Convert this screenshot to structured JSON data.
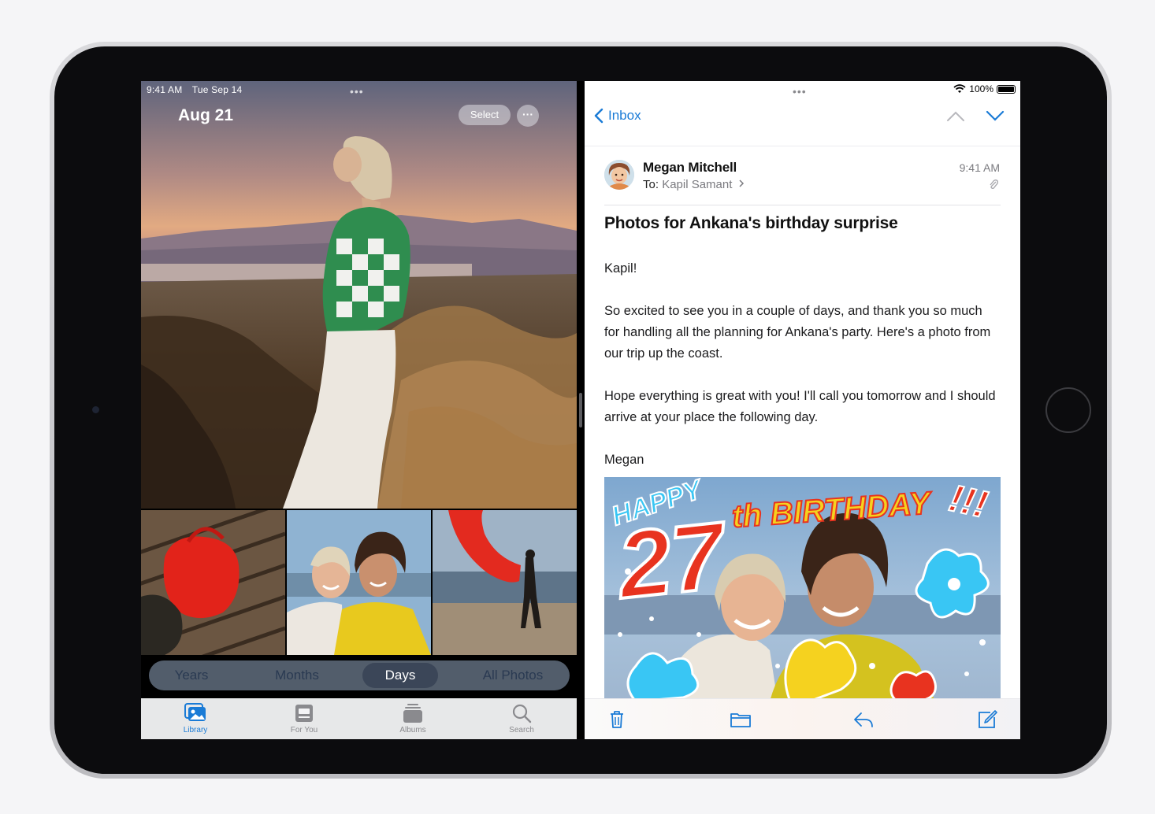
{
  "status": {
    "time": "9:41 AM",
    "date": "Tue Sep 14",
    "battery": "100%"
  },
  "photos": {
    "date_title": "Aug 21",
    "select_label": "Select",
    "more_label": "···",
    "segments": [
      "Years",
      "Months",
      "Days",
      "All Photos"
    ],
    "active_segment": "Days",
    "tabs": [
      {
        "label": "Library",
        "icon": "photo-library-icon",
        "active": true
      },
      {
        "label": "For You",
        "icon": "for-you-icon",
        "active": false
      },
      {
        "label": "Albums",
        "icon": "albums-icon",
        "active": false
      },
      {
        "label": "Search",
        "icon": "search-icon",
        "active": false
      }
    ]
  },
  "mail": {
    "back_label": "Inbox",
    "sender": "Megan Mitchell",
    "to_prefix": "To:",
    "recipient": "Kapil Samant",
    "time": "9:41 AM",
    "subject": "Photos for Ankana's birthday surprise",
    "greeting": "Kapil!",
    "paragraph1": "So excited to see you in a couple of days, and thank you so much for handling all the planning for Ankana's party. Here's a photo from our trip up the coast.",
    "paragraph2": "Hope everything is great with you! I'll call you tomorrow and I should arrive at your place the following day.",
    "signoff": "Megan",
    "card_text": {
      "happy": "HAPPY",
      "number": "27",
      "suffix": "th BIRTHDAY",
      "bang": "!!!"
    },
    "toolbar": [
      "trash-icon",
      "folder-icon",
      "reply-icon",
      "compose-icon"
    ]
  },
  "colors": {
    "accent": "#1a7bd6",
    "card_red": "#e8331f",
    "card_yellow": "#f5d21f",
    "card_blue": "#39c6f4"
  }
}
